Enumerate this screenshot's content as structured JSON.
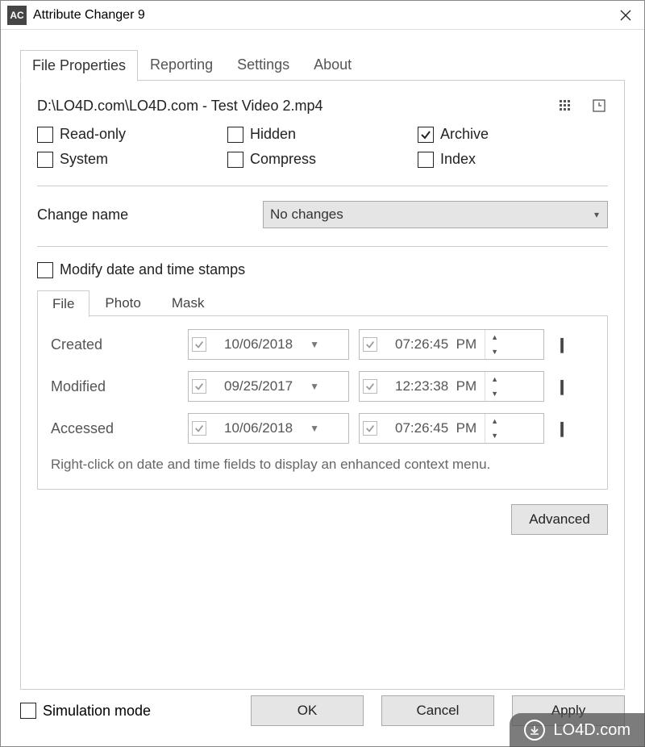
{
  "window": {
    "title": "Attribute Changer 9",
    "appicon_text": "AC"
  },
  "tabs": {
    "t0": "File Properties",
    "t1": "Reporting",
    "t2": "Settings",
    "t3": "About"
  },
  "file": {
    "path": "D:\\LO4D.com\\LO4D.com - Test Video 2.mp4"
  },
  "attrs": {
    "readonly": "Read-only",
    "hidden": "Hidden",
    "archive": "Archive",
    "system": "System",
    "compress": "Compress",
    "index": "Index"
  },
  "changename": {
    "label": "Change name",
    "value": "No changes"
  },
  "modify": {
    "label": "Modify date and time stamps"
  },
  "subtabs": {
    "s0": "File",
    "s1": "Photo",
    "s2": "Mask"
  },
  "dt": {
    "created": {
      "label": "Created",
      "date": "10/06/2018",
      "time": "07:26:45",
      "ampm": "PM"
    },
    "modified": {
      "label": "Modified",
      "date": "09/25/2017",
      "time": "12:23:38",
      "ampm": "PM"
    },
    "accessed": {
      "label": "Accessed",
      "date": "10/06/2018",
      "time": "07:26:45",
      "ampm": "PM"
    },
    "hint": "Right-click on date and time fields to display an enhanced context menu."
  },
  "buttons": {
    "advanced": "Advanced",
    "ok": "OK",
    "cancel": "Cancel",
    "apply": "Apply"
  },
  "simmode": "Simulation mode",
  "watermark": "LO4D.com"
}
